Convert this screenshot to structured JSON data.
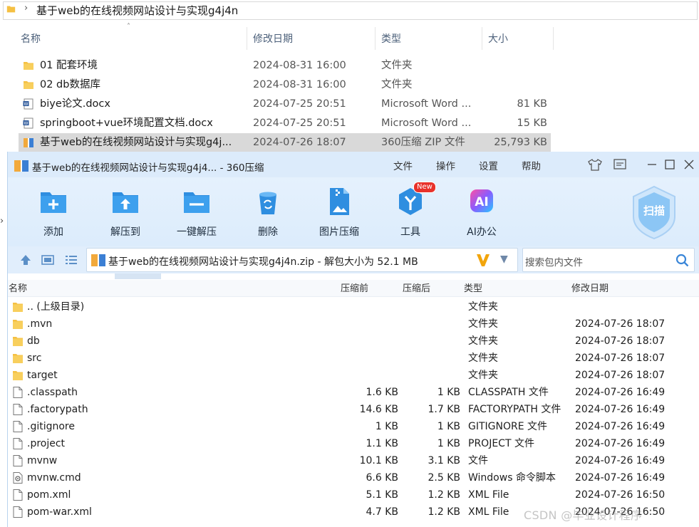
{
  "explorer": {
    "path": "基于web的在线视频网站设计与实现g4j4n",
    "columns": {
      "name": "名称",
      "date": "修改日期",
      "type": "类型",
      "size": "大小"
    },
    "files": [
      {
        "name": "01 配套环境",
        "date": "2024-08-31 16:00",
        "type": "文件夹",
        "size": "",
        "icon": "folder-icon"
      },
      {
        "name": "02 db数据库",
        "date": "2024-08-31 16:00",
        "type": "文件夹",
        "size": "",
        "icon": "folder-icon"
      },
      {
        "name": "biye论文.docx",
        "date": "2024-07-25 20:51",
        "type": "Microsoft Word ...",
        "size": "81 KB",
        "icon": "word-doc-icon"
      },
      {
        "name": "springboot+vue环境配置文档.docx",
        "date": "2024-07-25 20:51",
        "type": "Microsoft Word ...",
        "size": "15 KB",
        "icon": "word-doc-icon"
      },
      {
        "name": "基于web的在线视频网站设计与实现g4j...",
        "date": "2024-07-26 18:07",
        "type": "360压缩 ZIP 文件",
        "size": "25,793 KB",
        "icon": "zip-archive-icon"
      }
    ]
  },
  "zip": {
    "title": "基于web的在线视频网站设计与实现g4j4... - 360压缩",
    "menu": [
      "文件",
      "操作",
      "设置",
      "帮助"
    ],
    "toolbar": [
      {
        "label": "添加",
        "icon": "add-icon"
      },
      {
        "label": "解压到",
        "icon": "extract-to-icon"
      },
      {
        "label": "一键解压",
        "icon": "one-click-extract-icon"
      },
      {
        "label": "删除",
        "icon": "delete-icon"
      },
      {
        "label": "图片压缩",
        "icon": "image-compress-icon"
      },
      {
        "label": "工具",
        "icon": "tools-icon",
        "badge": "New"
      },
      {
        "label": "AI办公",
        "icon": "ai-office-icon",
        "badge_text": "AI"
      }
    ],
    "scan_label": "扫描",
    "address": "基于web的在线视频网站设计与实现g4j4n.zip - 解包大小为 52.1 MB",
    "search_placeholder": "搜索包内文件",
    "columns": {
      "name": "名称",
      "before": "压缩前",
      "after": "压缩后",
      "type": "类型",
      "date": "修改日期"
    },
    "files": [
      {
        "name": ".. (上级目录)",
        "before": "",
        "after": "",
        "type": "文件夹",
        "date": "",
        "icon": "folder-icon"
      },
      {
        "name": ".mvn",
        "before": "",
        "after": "",
        "type": "文件夹",
        "date": "2024-07-26 18:07",
        "icon": "folder-icon"
      },
      {
        "name": "db",
        "before": "",
        "after": "",
        "type": "文件夹",
        "date": "2024-07-26 18:07",
        "icon": "folder-icon"
      },
      {
        "name": "src",
        "before": "",
        "after": "",
        "type": "文件夹",
        "date": "2024-07-26 18:07",
        "icon": "folder-icon"
      },
      {
        "name": "target",
        "before": "",
        "after": "",
        "type": "文件夹",
        "date": "2024-07-26 18:07",
        "icon": "folder-icon"
      },
      {
        "name": ".classpath",
        "before": "1.6 KB",
        "after": "1 KB",
        "type": "CLASSPATH 文件",
        "date": "2024-07-26 16:49",
        "icon": "file-icon"
      },
      {
        "name": ".factorypath",
        "before": "14.6 KB",
        "after": "1.7 KB",
        "type": "FACTORYPATH 文件",
        "date": "2024-07-26 16:49",
        "icon": "file-icon"
      },
      {
        "name": ".gitignore",
        "before": "1 KB",
        "after": "1 KB",
        "type": "GITIGNORE 文件",
        "date": "2024-07-26 16:49",
        "icon": "file-icon"
      },
      {
        "name": ".project",
        "before": "1.1 KB",
        "after": "1 KB",
        "type": "PROJECT 文件",
        "date": "2024-07-26 16:49",
        "icon": "file-icon"
      },
      {
        "name": "mvnw",
        "before": "10.1 KB",
        "after": "3.1 KB",
        "type": "文件",
        "date": "2024-07-26 16:49",
        "icon": "file-icon"
      },
      {
        "name": "mvnw.cmd",
        "before": "6.6 KB",
        "after": "2.5 KB",
        "type": "Windows 命令脚本",
        "date": "2024-07-26 16:49",
        "icon": "cmd-script-icon"
      },
      {
        "name": "pom.xml",
        "before": "5.1 KB",
        "after": "1.2 KB",
        "type": "XML File",
        "date": "2024-07-26 16:50",
        "icon": "file-icon"
      },
      {
        "name": "pom-war.xml",
        "before": "4.7 KB",
        "after": "1.2 KB",
        "type": "XML File",
        "date": "2024-07-26 16:50",
        "icon": "file-icon"
      }
    ]
  },
  "watermark": "CSDN @毕业设计程序",
  "colors": {
    "accent": "#2f8ee0",
    "titlebar": "#dcebfb",
    "toolbar": "#e3f0fd",
    "folder": "#f5c043",
    "selection": "#d9d9d9",
    "v_logo": "#f2a50c"
  }
}
